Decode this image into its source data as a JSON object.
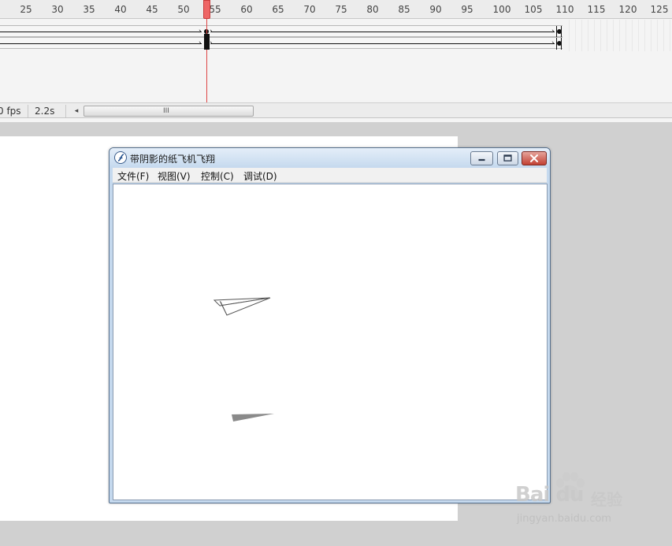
{
  "timeline": {
    "ruler_ticks": [
      "25",
      "30",
      "35",
      "40",
      "45",
      "50",
      "55",
      "60",
      "65",
      "70",
      "75",
      "80",
      "85",
      "90",
      "95",
      "100",
      "105",
      "110",
      "115",
      "120",
      "125"
    ],
    "status": {
      "fps": "0 fps",
      "time": "2.2s"
    },
    "scroll_left_glyph": "◂",
    "scroll_grip_glyph": "III",
    "playhead_color": "#ee6666"
  },
  "preview_window": {
    "title": "带阴影的纸飞机飞翔",
    "menus": [
      "文件(F)",
      "视图(V)",
      "控制(C)",
      "调试(D)"
    ],
    "controls": [
      "minimize-icon",
      "maximize-icon",
      "close-icon"
    ],
    "close_color": "#c24133"
  },
  "watermark": {
    "logo": "Bai du",
    "logo_cn": "经验",
    "url": "jingyan.baidu.com"
  }
}
